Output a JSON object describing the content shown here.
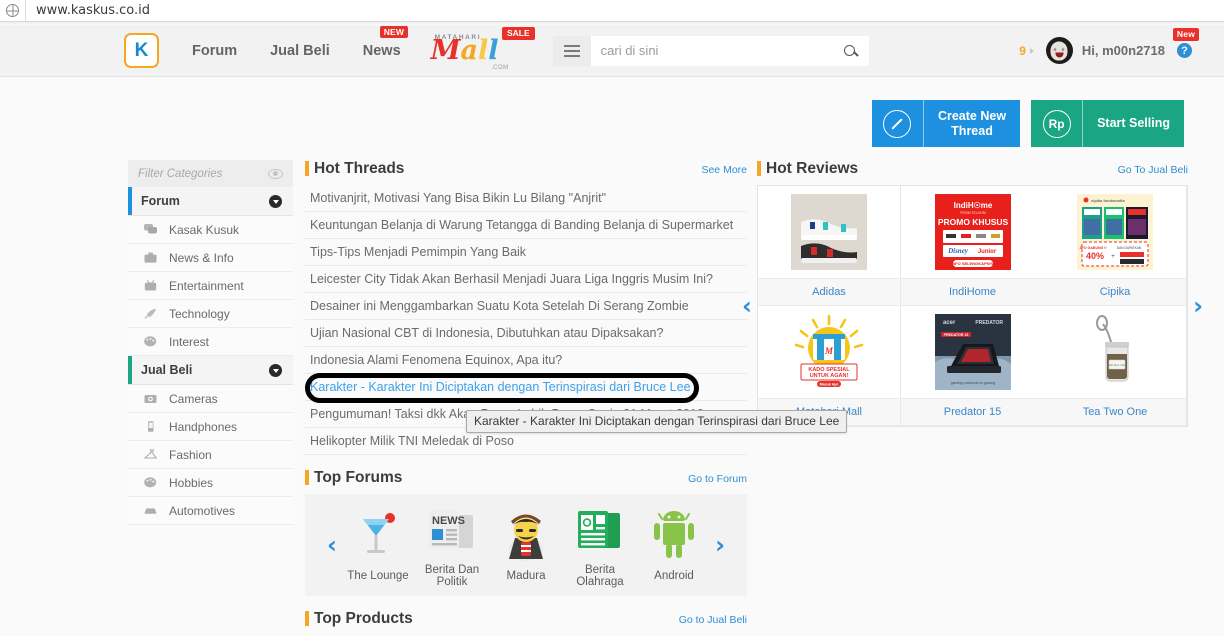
{
  "browser": {
    "url": "www.kaskus.co.id",
    "site_info_icon": "globe-icon"
  },
  "header": {
    "logo_text": "K",
    "nav": [
      {
        "label": "Forum",
        "badge": ""
      },
      {
        "label": "Jual Beli",
        "badge": ""
      },
      {
        "label": "News",
        "badge": "NEW"
      }
    ],
    "mall_logo": {
      "top": "MATAHARI",
      "word": [
        "M",
        "a",
        "l",
        "l"
      ],
      "bottom": ".COM",
      "badge": "SALE"
    },
    "search": {
      "placeholder": "cari di sini",
      "value": "",
      "menu_icon": "hamburger-icon",
      "search_icon": "search-icon"
    },
    "user": {
      "notification_count": "9",
      "greeting": "Hi, m00n2718",
      "new_badge": "New",
      "help_icon": "question-mark-icon"
    }
  },
  "actions": {
    "create_thread": {
      "label": "Create New\nThread",
      "icon": "pencil-icon",
      "color": "#1e90e0"
    },
    "start_selling": {
      "label": "Start Selling",
      "icon": "rupiah-icon",
      "color": "#1aa683"
    }
  },
  "sidebar": {
    "filter": {
      "placeholder": "Filter Categories",
      "value": "",
      "icon": "eye-icon"
    },
    "groups": [
      {
        "label": "Forum",
        "accent": "#1e90e0",
        "items": [
          {
            "label": "Kasak Kusuk",
            "icon": "chat-bubbles-icon",
            "glyph": "✉"
          },
          {
            "label": "News & Info",
            "icon": "briefcase-icon",
            "glyph": "▮"
          },
          {
            "label": "Entertainment",
            "icon": "tv-icon",
            "glyph": "▣"
          },
          {
            "label": "Technology",
            "icon": "rocket-icon",
            "glyph": "✈"
          },
          {
            "label": "Interest",
            "icon": "palette-icon",
            "glyph": "✿"
          }
        ]
      },
      {
        "label": "Jual Beli",
        "accent": "#1aa683",
        "items": [
          {
            "label": "Cameras",
            "icon": "camera-icon",
            "glyph": "■"
          },
          {
            "label": "Handphones",
            "icon": "phone-icon",
            "glyph": "▀"
          },
          {
            "label": "Fashion",
            "icon": "hanger-icon",
            "glyph": "☂"
          },
          {
            "label": "Hobbies",
            "icon": "palette-icon",
            "glyph": "✿"
          },
          {
            "label": "Automotives",
            "icon": "car-icon",
            "glyph": "▬"
          }
        ]
      }
    ]
  },
  "hot_threads": {
    "title": "Hot Threads",
    "see_more": "See More",
    "items": [
      {
        "title": "Motivanjrit, Motivasi Yang Bisa Bikin Lu Bilang \"Anjrit\"",
        "highlighted": false
      },
      {
        "title": "Keuntungan Belanja di Warung Tetangga di Banding Belanja di Supermarket",
        "highlighted": false
      },
      {
        "title": "Tips-Tips Menjadi Pemimpin Yang Baik",
        "highlighted": false
      },
      {
        "title": "Leicester City Tidak Akan Berhasil Menjadi Juara Liga Inggris Musim Ini?",
        "highlighted": false
      },
      {
        "title": "Desainer ini Menggambarkan Suatu Kota Setelah Di Serang Zombie",
        "highlighted": false
      },
      {
        "title": "Ujian Nasional CBT di Indonesia, Dibutuhkan atau Dipaksakan?",
        "highlighted": false
      },
      {
        "title": "Indonesia Alami Fenomena Equinox, Apa itu?",
        "highlighted": false
      },
      {
        "title": "Karakter - Karakter Ini Diciptakan dengan Terinspirasi dari Bruce Lee",
        "highlighted": true
      },
      {
        "title": "Pengumuman! Taksi dkk Akan Demo Lebih Besar Senin 21 Maret 2016",
        "highlighted": false
      },
      {
        "title": "Helikopter Milik TNI Meledak di Poso",
        "highlighted": false
      }
    ]
  },
  "tooltip": {
    "text": "Karakter - Karakter Ini Diciptakan dengan Terinspirasi dari Bruce Lee"
  },
  "annotation": {
    "shape": "black-oval-highlight",
    "target": "Karakter - Karakter Ini Diciptakan dengan Terinspirasi dari Bruce Lee"
  },
  "hot_reviews": {
    "title": "Hot Reviews",
    "link": "Go To Jual Beli",
    "prev_icon": "chevron-left-icon",
    "next_icon": "chevron-right-icon",
    "items": [
      {
        "label": "Adidas",
        "thumb": "sneakers-photo"
      },
      {
        "label": "IndiHome",
        "thumb": "indihome-promo-banner"
      },
      {
        "label": "Cipika",
        "thumb": "cipika-honest-banner"
      },
      {
        "label": "Matahari Mall",
        "thumb": "kado-spesial-banner"
      },
      {
        "label": "Predator 15",
        "thumb": "acer-predator-laptop"
      },
      {
        "label": "Tea Two One",
        "thumb": "tea-jar-photo"
      }
    ]
  },
  "top_forums": {
    "title": "Top Forums",
    "link": "Go to Forum",
    "prev_icon": "chevron-left-icon",
    "next_icon": "chevron-right-icon",
    "items": [
      {
        "label": "The Lounge",
        "icon": "cocktail-glass-icon"
      },
      {
        "label": "Berita Dan Politik",
        "icon": "newspaper-icon"
      },
      {
        "label": "Madura",
        "icon": "madura-character-icon"
      },
      {
        "label": "Berita Olahraga",
        "icon": "sports-news-icon"
      },
      {
        "label": "Android",
        "icon": "android-robot-icon"
      }
    ]
  },
  "top_products": {
    "title": "Top Products",
    "link": "Go to Jual Beli"
  }
}
